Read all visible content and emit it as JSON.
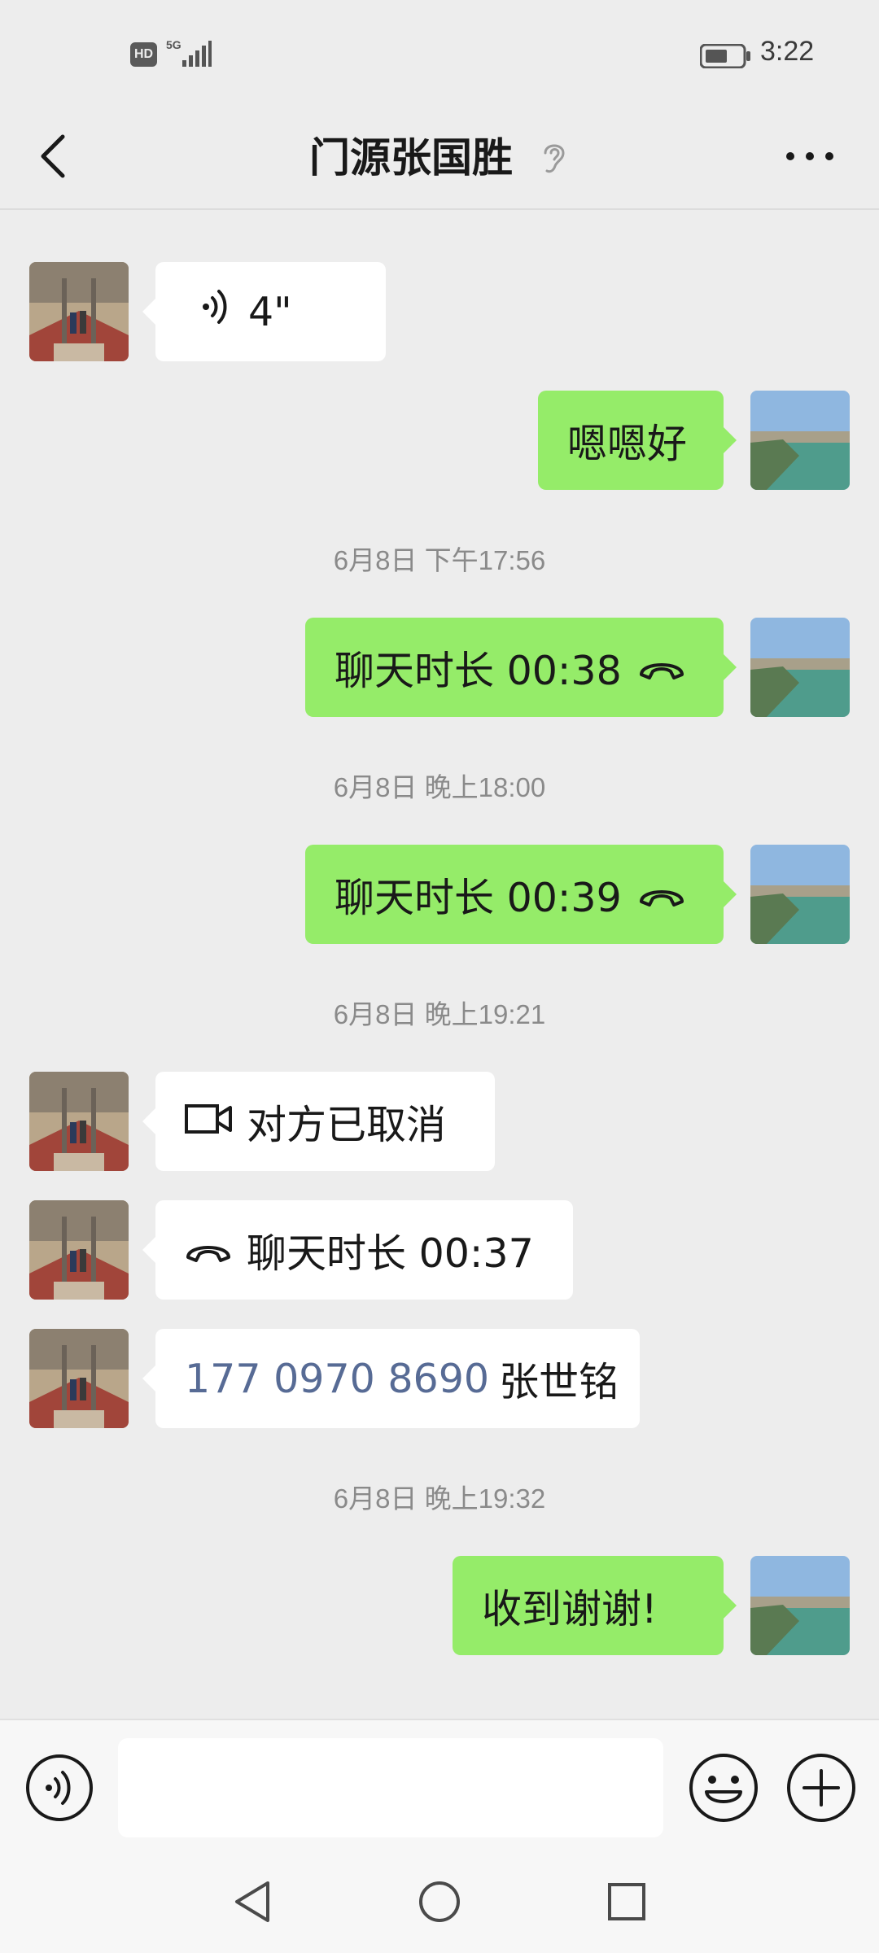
{
  "status_bar": {
    "hd_label": "HD",
    "network_label": "5G",
    "time": "3:22",
    "icons": [
      "hd-icon",
      "signal-icon",
      "battery-icon"
    ]
  },
  "header": {
    "title": "门源张国胜",
    "back_icon": "chevron-left-icon",
    "earpiece_icon": "ear-icon",
    "more_icon": "more-dots-icon"
  },
  "messages": [
    {
      "type": "voice",
      "side": "incoming",
      "duration": "4\""
    },
    {
      "type": "text",
      "side": "outgoing",
      "text": "嗯嗯好"
    },
    {
      "type": "timestamp",
      "text": "6月8日 下午17:56"
    },
    {
      "type": "call",
      "side": "outgoing",
      "text": "聊天时长 00:38"
    },
    {
      "type": "timestamp",
      "text": "6月8日 晚上18:00"
    },
    {
      "type": "call",
      "side": "outgoing",
      "text": "聊天时长 00:39"
    },
    {
      "type": "timestamp",
      "text": "6月8日 晚上19:21"
    },
    {
      "type": "video_call",
      "side": "incoming",
      "text": "对方已取消"
    },
    {
      "type": "call",
      "side": "incoming",
      "text": "聊天时长 00:37"
    },
    {
      "type": "contact",
      "side": "incoming",
      "phone": "177 0970 8690",
      "name": "张世铭"
    },
    {
      "type": "timestamp",
      "text": "6月8日 晚上19:32"
    },
    {
      "type": "text",
      "side": "outgoing",
      "text": "收到谢谢!"
    }
  ],
  "input_bar": {
    "value": "",
    "voice_icon": "voice-mode-icon",
    "emoji_icon": "emoji-icon",
    "plus_icon": "plus-icon"
  },
  "system_nav": {
    "icons": [
      "nav-back-icon",
      "nav-home-icon",
      "nav-recents-icon"
    ]
  },
  "colors": {
    "background": "#ededed",
    "outgoing_bubble": "#95ec69",
    "incoming_bubble": "#ffffff",
    "link": "#576b95",
    "timestamp": "#8a8a8a"
  }
}
